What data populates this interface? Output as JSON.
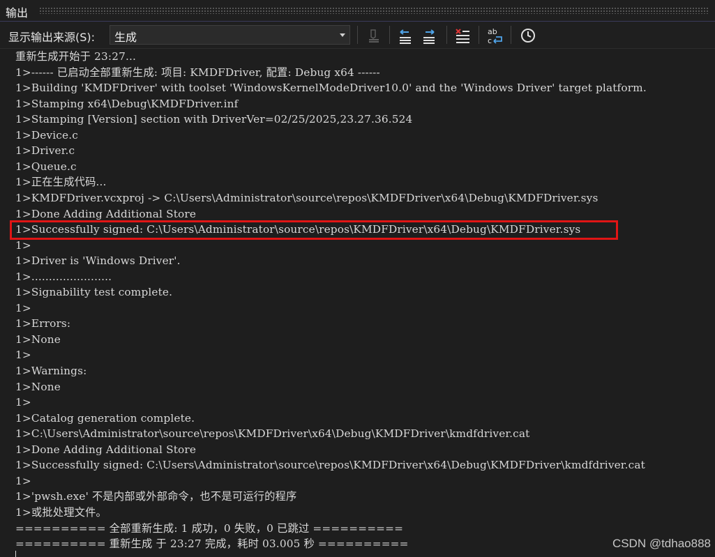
{
  "window": {
    "title": "输出"
  },
  "toolbar": {
    "source_label": "显示输出来源(S):",
    "source_value": "生成",
    "icons": [
      "find-message-icon",
      "go-to-previous-icon",
      "go-to-next-icon",
      "clear-all-icon",
      "word-wrap-icon",
      "clock-icon"
    ]
  },
  "output": {
    "lines": [
      "重新生成开始于 23:27...",
      "1>------ 已启动全部重新生成: 项目: KMDFDriver, 配置: Debug x64 ------",
      "1>Building 'KMDFDriver' with toolset 'WindowsKernelModeDriver10.0' and the 'Windows Driver' target platform.",
      "1>Stamping x64\\Debug\\KMDFDriver.inf",
      "1>Stamping [Version] section with DriverVer=02/25/2025,23.27.36.524",
      "1>Device.c",
      "1>Driver.c",
      "1>Queue.c",
      "1>正在生成代码...",
      "1>KMDFDriver.vcxproj -> C:\\Users\\Administrator\\source\\repos\\KMDFDriver\\x64\\Debug\\KMDFDriver.sys",
      "1>Done Adding Additional Store",
      "1>Successfully signed: C:\\Users\\Administrator\\source\\repos\\KMDFDriver\\x64\\Debug\\KMDFDriver.sys",
      "1>",
      "1>Driver is 'Windows Driver'.",
      "1>.......................",
      "1>Signability test complete.",
      "1>",
      "1>Errors:",
      "1>None",
      "1>",
      "1>Warnings:",
      "1>None",
      "1>",
      "1>Catalog generation complete.",
      "1>C:\\Users\\Administrator\\source\\repos\\KMDFDriver\\x64\\Debug\\KMDFDriver\\kmdfdriver.cat",
      "1>Done Adding Additional Store",
      "1>Successfully signed: C:\\Users\\Administrator\\source\\repos\\KMDFDriver\\x64\\Debug\\KMDFDriver\\kmdfdriver.cat",
      "1>",
      "1>'pwsh.exe' 不是内部或外部命令，也不是可运行的程序",
      "1>或批处理文件。",
      "========== 全部重新生成: 1 成功，0 失败，0 已跳过 ==========",
      "========== 重新生成 于 23:27 完成，耗时 03.005 秒 =========="
    ]
  },
  "watermark": "CSDN @tdhao888",
  "colors": {
    "highlight": "#e01515",
    "background": "#1e1e1e",
    "text": "#d8d8d8"
  }
}
